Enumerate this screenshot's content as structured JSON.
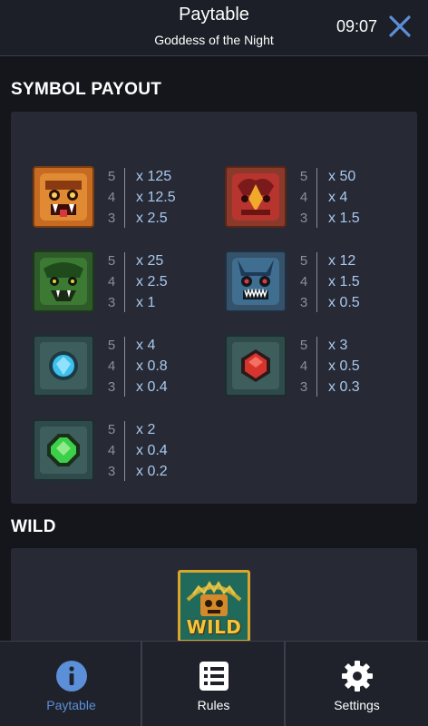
{
  "header": {
    "title": "Paytable",
    "subtitle": "Goddess of the Night",
    "time": "09:07",
    "close_icon": "close-icon"
  },
  "symbol_section": {
    "title": "SYMBOL PAYOUT",
    "symbols": [
      {
        "icon": "orange-jaguar-mask-icon",
        "counts": [
          "5",
          "4",
          "3"
        ],
        "pays": [
          "x 125",
          "x 12.5",
          "x 2.5"
        ]
      },
      {
        "icon": "red-bird-mask-icon",
        "counts": [
          "5",
          "4",
          "3"
        ],
        "pays": [
          "x 50",
          "x 4",
          "x 1.5"
        ]
      },
      {
        "icon": "green-serpent-mask-icon",
        "counts": [
          "5",
          "4",
          "3"
        ],
        "pays": [
          "x 25",
          "x 2.5",
          "x 1"
        ]
      },
      {
        "icon": "blue-demon-mask-icon",
        "counts": [
          "5",
          "4",
          "3"
        ],
        "pays": [
          "x 12",
          "x 1.5",
          "x 0.5"
        ]
      },
      {
        "icon": "blue-gem-icon",
        "counts": [
          "5",
          "4",
          "3"
        ],
        "pays": [
          "x 4",
          "x 0.8",
          "x 0.4"
        ]
      },
      {
        "icon": "red-gem-icon",
        "counts": [
          "5",
          "4",
          "3"
        ],
        "pays": [
          "x 3",
          "x 0.5",
          "x 0.3"
        ]
      },
      {
        "icon": "green-gem-icon",
        "counts": [
          "5",
          "4",
          "3"
        ],
        "pays": [
          "x 2",
          "x 0.4",
          "x 0.2"
        ]
      }
    ]
  },
  "wild_section": {
    "title": "WILD",
    "wild_symbol_text": "WILD"
  },
  "bottom_tabs": [
    {
      "label": "Paytable",
      "icon": "info-icon",
      "active": true
    },
    {
      "label": "Rules",
      "icon": "list-icon",
      "active": false
    },
    {
      "label": "Settings",
      "icon": "gear-icon",
      "active": false
    }
  ],
  "colors": {
    "accent": "#5b8fd8",
    "payout_text": "#a9c8ee",
    "panel": "#272a34",
    "background": "#14161c"
  }
}
